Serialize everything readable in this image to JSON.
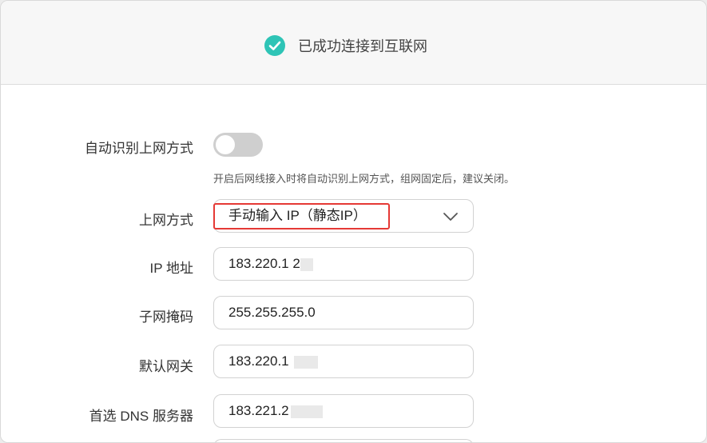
{
  "status": {
    "text": "已成功连接到互联网",
    "icon": "check-circle-icon",
    "icon_color": "#2ec4b6"
  },
  "auto_detect": {
    "label": "自动识别上网方式",
    "enabled": false,
    "hint": "开启后网线接入时将自动识别上网方式，组网固定后，建议关闭。"
  },
  "connection_type": {
    "label": "上网方式",
    "value": "手动输入 IP（静态IP）",
    "icon": "chevron-down-icon",
    "highlight_color": "#e53935"
  },
  "ip_address": {
    "label": "IP 地址",
    "value": "183.220.1   2"
  },
  "subnet_mask": {
    "label": "子网掩码",
    "value": "255.255.255.0"
  },
  "gateway": {
    "label": "默认网关",
    "value": "183.220.1"
  },
  "dns_primary": {
    "label": "首选 DNS 服务器",
    "value": "183.221.2      0"
  }
}
